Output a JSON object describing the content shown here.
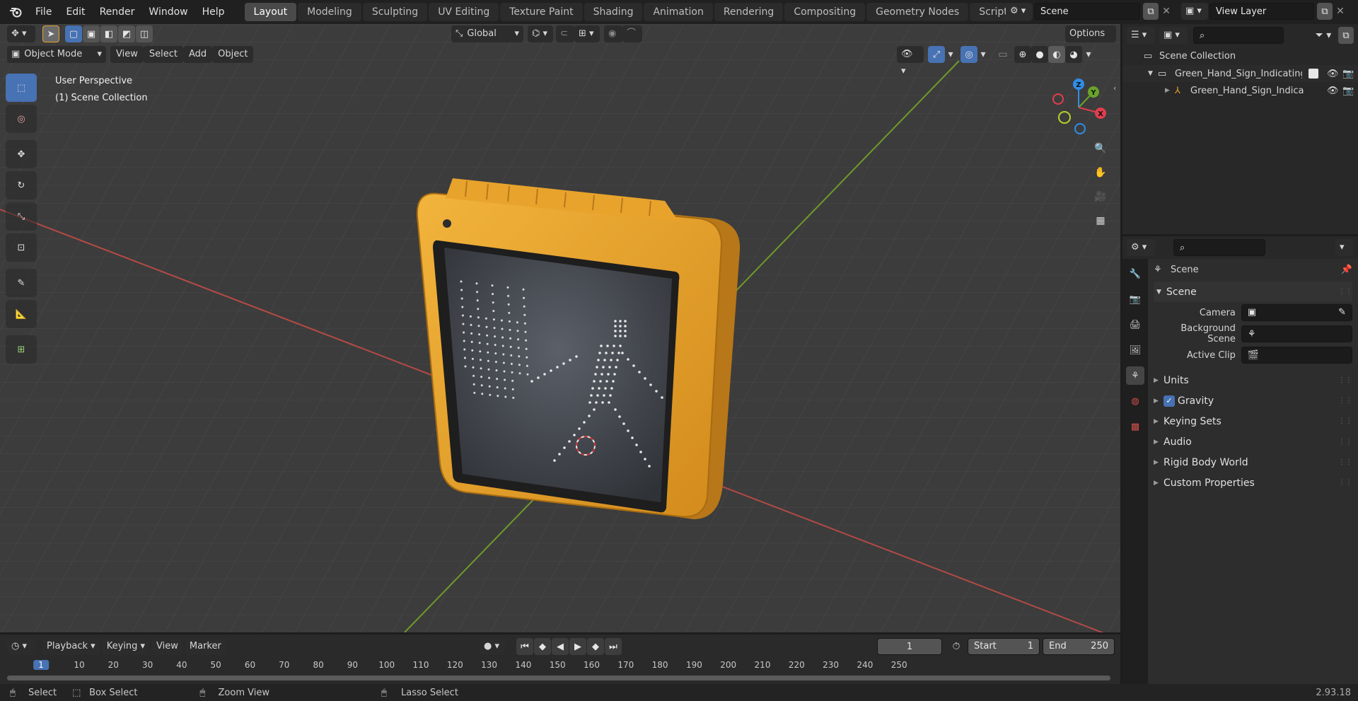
{
  "menu": [
    "File",
    "Edit",
    "Render",
    "Window",
    "Help"
  ],
  "workspaces": [
    "Layout",
    "Modeling",
    "Sculpting",
    "UV Editing",
    "Texture Paint",
    "Shading",
    "Animation",
    "Rendering",
    "Compositing",
    "Geometry Nodes",
    "Scripting"
  ],
  "scene_field": "Scene",
  "view_layer_field": "View Layer",
  "viewport": {
    "orientation": "Global",
    "options": "Options",
    "mode": "Object Mode",
    "menus": [
      "View",
      "Select",
      "Add",
      "Object"
    ],
    "perspective": "User Perspective",
    "collection": "(1) Scene Collection"
  },
  "gizmo": {
    "z": "Z",
    "y": "Y",
    "x": "X"
  },
  "outliner": {
    "root": "Scene Collection",
    "items": [
      "Green_Hand_Sign_Indicating_",
      "Green_Hand_Sign_Indical"
    ]
  },
  "properties": {
    "context": "Scene",
    "panel": "Scene",
    "camera_label": "Camera",
    "background_label": "Background Scene",
    "clip_label": "Active Clip",
    "subpanels": [
      "Units",
      "Gravity",
      "Keying Sets",
      "Audio",
      "Rigid Body World",
      "Custom Properties"
    ]
  },
  "timeline": {
    "menus": [
      "Playback",
      "Keying",
      "View",
      "Marker"
    ],
    "current_frame": "1",
    "start_label": "Start",
    "start": "1",
    "end_label": "End",
    "end": "250",
    "ruler": [
      "1",
      "10",
      "20",
      "30",
      "40",
      "50",
      "60",
      "70",
      "80",
      "90",
      "100",
      "110",
      "120",
      "130",
      "140",
      "150",
      "160",
      "170",
      "180",
      "190",
      "200",
      "210",
      "220",
      "230",
      "240",
      "250"
    ]
  },
  "status": {
    "select": "Select",
    "box_select": "Box Select",
    "zoom_view": "Zoom View",
    "lasso_select": "Lasso Select",
    "version": "2.93.18"
  },
  "colors": {
    "accent": "#4772b3",
    "sign_frame": "#e8a32c",
    "axis_x": "#c8443f",
    "axis_y": "#7ab02a",
    "gizmo_z": "#2f8ee8",
    "gizmo_y": "#6aa329",
    "gizmo_x": "#e03e4e"
  }
}
